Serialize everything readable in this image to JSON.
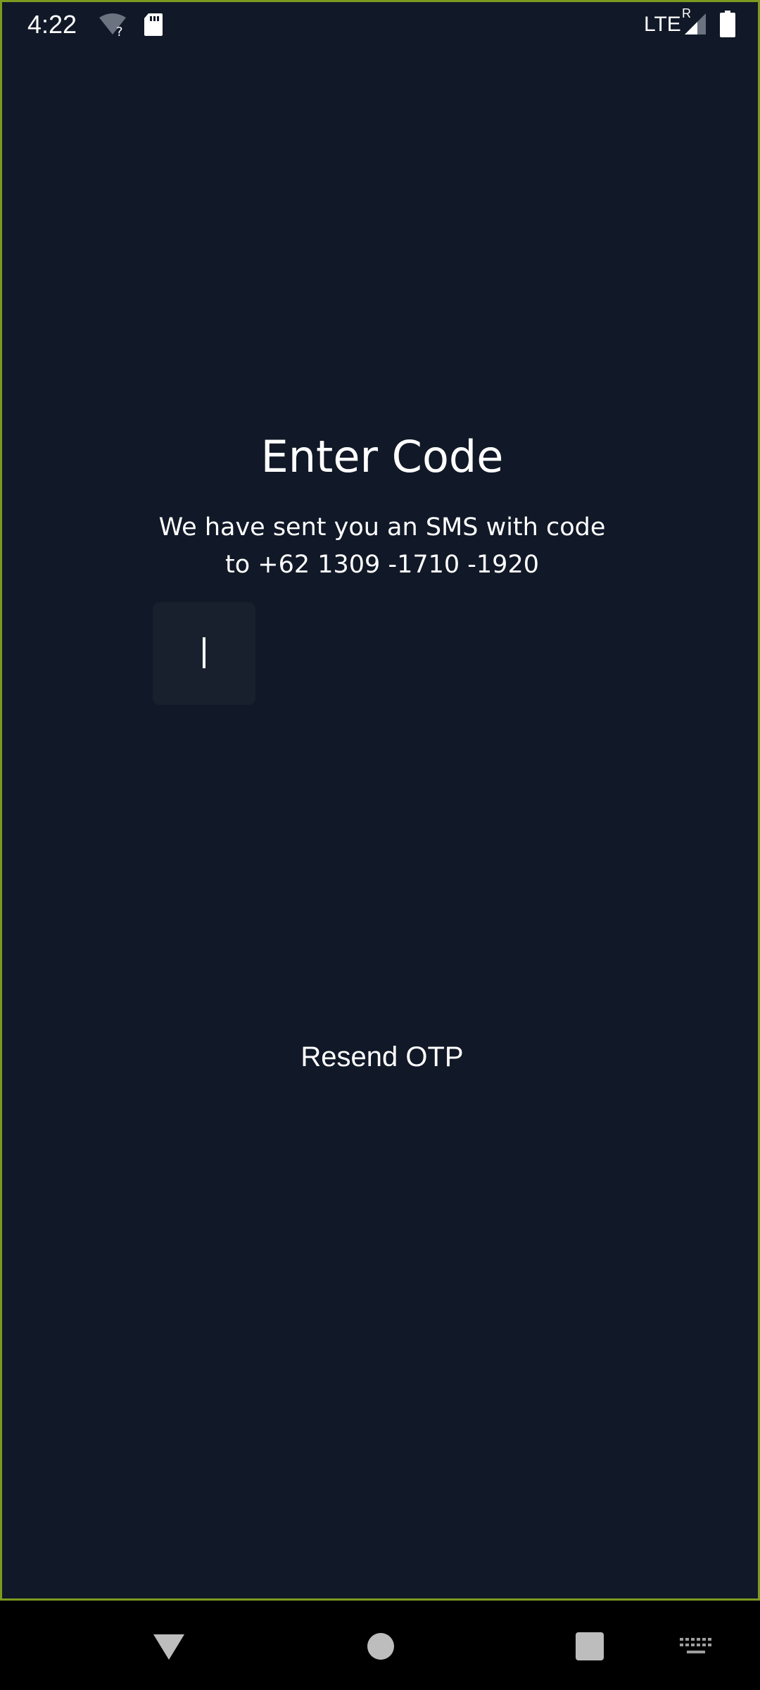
{
  "status_bar": {
    "time": "4:22",
    "network": "LTE",
    "roaming": "R",
    "icons": [
      "wifi-unknown-icon",
      "sd-card-icon",
      "signal-icon",
      "battery-icon"
    ]
  },
  "otp_screen": {
    "title": "Enter Code",
    "message_line1": "We have sent you an SMS with code",
    "message_line2": "to +62 1309 -1710 -1920",
    "otp_value": "",
    "resend_label": "Resend OTP"
  },
  "nav_bar": {
    "icons": [
      "back-icon",
      "home-icon",
      "recents-icon",
      "keyboard-icon"
    ]
  },
  "colors": {
    "background": "#111827",
    "input_background": "#18202e",
    "text": "#ffffff",
    "frame_border": "#7c9a1f"
  }
}
